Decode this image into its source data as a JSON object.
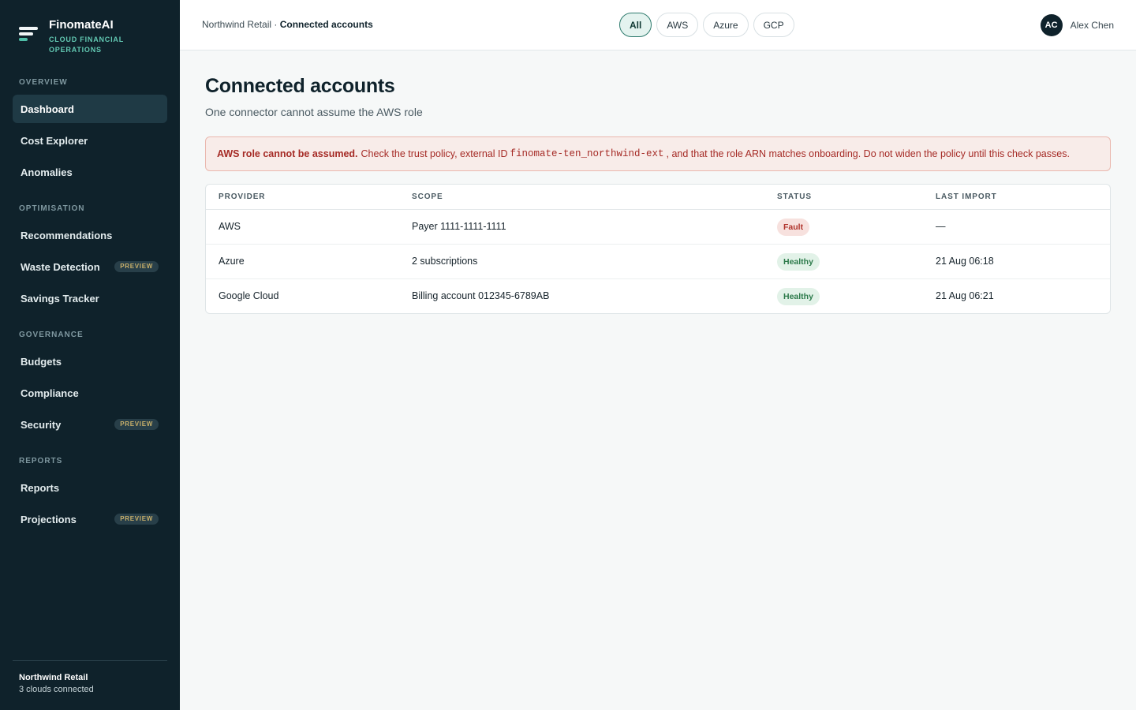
{
  "app": {
    "name": "FinomateAI",
    "tagline": "CLOUD FINANCIAL OPERATIONS"
  },
  "sidebar": {
    "sections": [
      {
        "label": "OVERVIEW"
      },
      {
        "label": "OPTIMISATION"
      },
      {
        "label": "GOVERNANCE"
      },
      {
        "label": "REPORTS"
      }
    ],
    "items": [
      {
        "label": "Dashboard",
        "active": true
      },
      {
        "label": "Cost Explorer"
      },
      {
        "label": "Anomalies"
      },
      {
        "label": "Recommendations"
      },
      {
        "label": "Waste Detection",
        "badge": "PREVIEW"
      },
      {
        "label": "Savings Tracker"
      },
      {
        "label": "Budgets"
      },
      {
        "label": "Compliance"
      },
      {
        "label": "Security",
        "badge": "PREVIEW"
      },
      {
        "label": "Reports"
      },
      {
        "label": "Projections",
        "badge": "PREVIEW"
      }
    ],
    "footer": {
      "org": "Northwind Retail",
      "status": "3 clouds connected"
    }
  },
  "header": {
    "breadcrumb": {
      "parent": "Northwind Retail",
      "separator": " · ",
      "current": "Connected accounts"
    },
    "filters": [
      {
        "label": "All",
        "active": true
      },
      {
        "label": "AWS"
      },
      {
        "label": "Azure"
      },
      {
        "label": "GCP"
      }
    ],
    "user": {
      "initials": "AC",
      "name": "Alex Chen"
    }
  },
  "page": {
    "title": "Connected accounts",
    "subtitle": "One connector cannot assume the AWS role"
  },
  "alert": {
    "title": "AWS role cannot be assumed.",
    "text_before": "Check the trust policy, external ID",
    "external_id": "finomate-ten_northwind-ext",
    "text_after": ", and that the role ARN matches onboarding. Do not widen the policy until this check passes.",
    "color": "#a52a25"
  },
  "table": {
    "columns": [
      "PROVIDER",
      "SCOPE",
      "STATUS",
      "LAST IMPORT"
    ],
    "rows": [
      {
        "provider": "AWS",
        "scope": "Payer 1111-1111-1111",
        "status": "Fault",
        "last_import": "—"
      },
      {
        "provider": "Azure",
        "scope": "2 subscriptions",
        "status": "Healthy",
        "last_import": "21 Aug 06:18"
      },
      {
        "provider": "Google Cloud",
        "scope": "Billing account 012345-6789AB",
        "status": "Healthy",
        "last_import": "21 Aug 06:21"
      }
    ]
  },
  "colors": {
    "sidebar_bg": "#0f222b",
    "accent": "#4fbfa8",
    "fault": "#b0342c",
    "healthy": "#2c7a4a"
  }
}
